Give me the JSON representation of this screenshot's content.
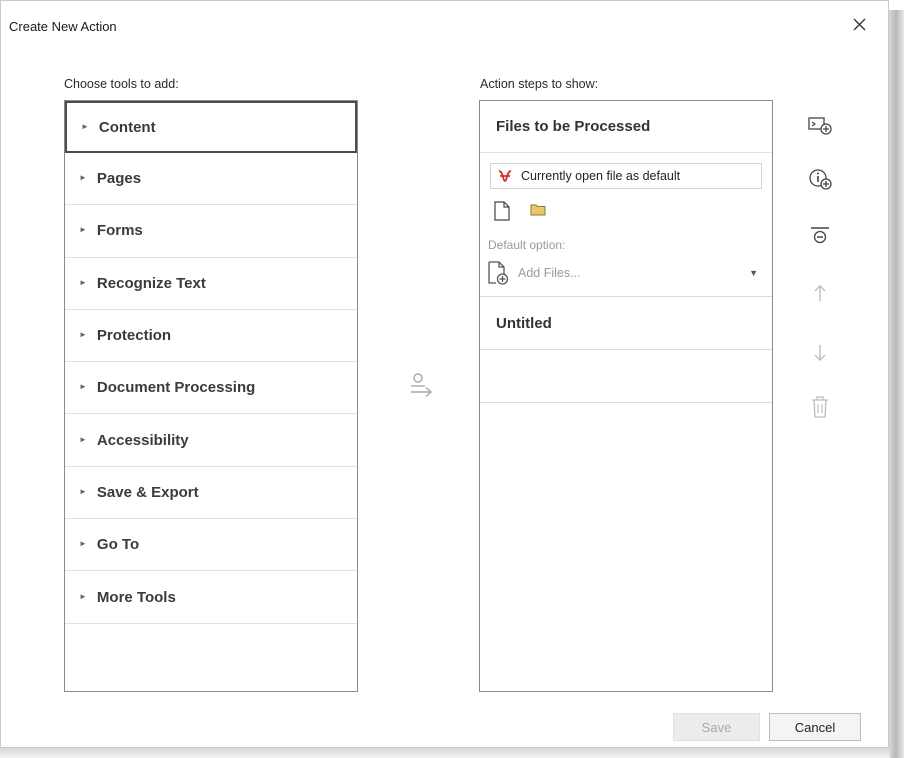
{
  "window": {
    "title": "Create New Action",
    "close_glyph": "close-icon"
  },
  "left_panel": {
    "label": "Choose tools to add:",
    "items": [
      {
        "label": "Content",
        "selected": true
      },
      {
        "label": "Pages"
      },
      {
        "label": "Forms"
      },
      {
        "label": "Recognize Text"
      },
      {
        "label": "Protection"
      },
      {
        "label": "Document Processing"
      },
      {
        "label": "Accessibility"
      },
      {
        "label": "Save & Export"
      },
      {
        "label": "Go To"
      },
      {
        "label": "More Tools"
      }
    ]
  },
  "right_panel": {
    "label": "Action steps to show:",
    "files_header": "Files to be Processed",
    "current_file": "Currently open file as default",
    "default_option_label": "Default option:",
    "add_files_placeholder": "Add Files...",
    "step_untitled": "Untitled"
  },
  "side_tools": [
    "add-panel-icon",
    "add-instruction-icon",
    "add-divider-icon",
    "move-up-icon",
    "move-down-icon",
    "delete-icon"
  ],
  "footer": {
    "save_label": "Save",
    "cancel_label": "Cancel"
  },
  "colors": {
    "pdf_red": "#d0312d",
    "folder_yellow": "#e8c86a",
    "border_dark": "#4d4d4d"
  }
}
